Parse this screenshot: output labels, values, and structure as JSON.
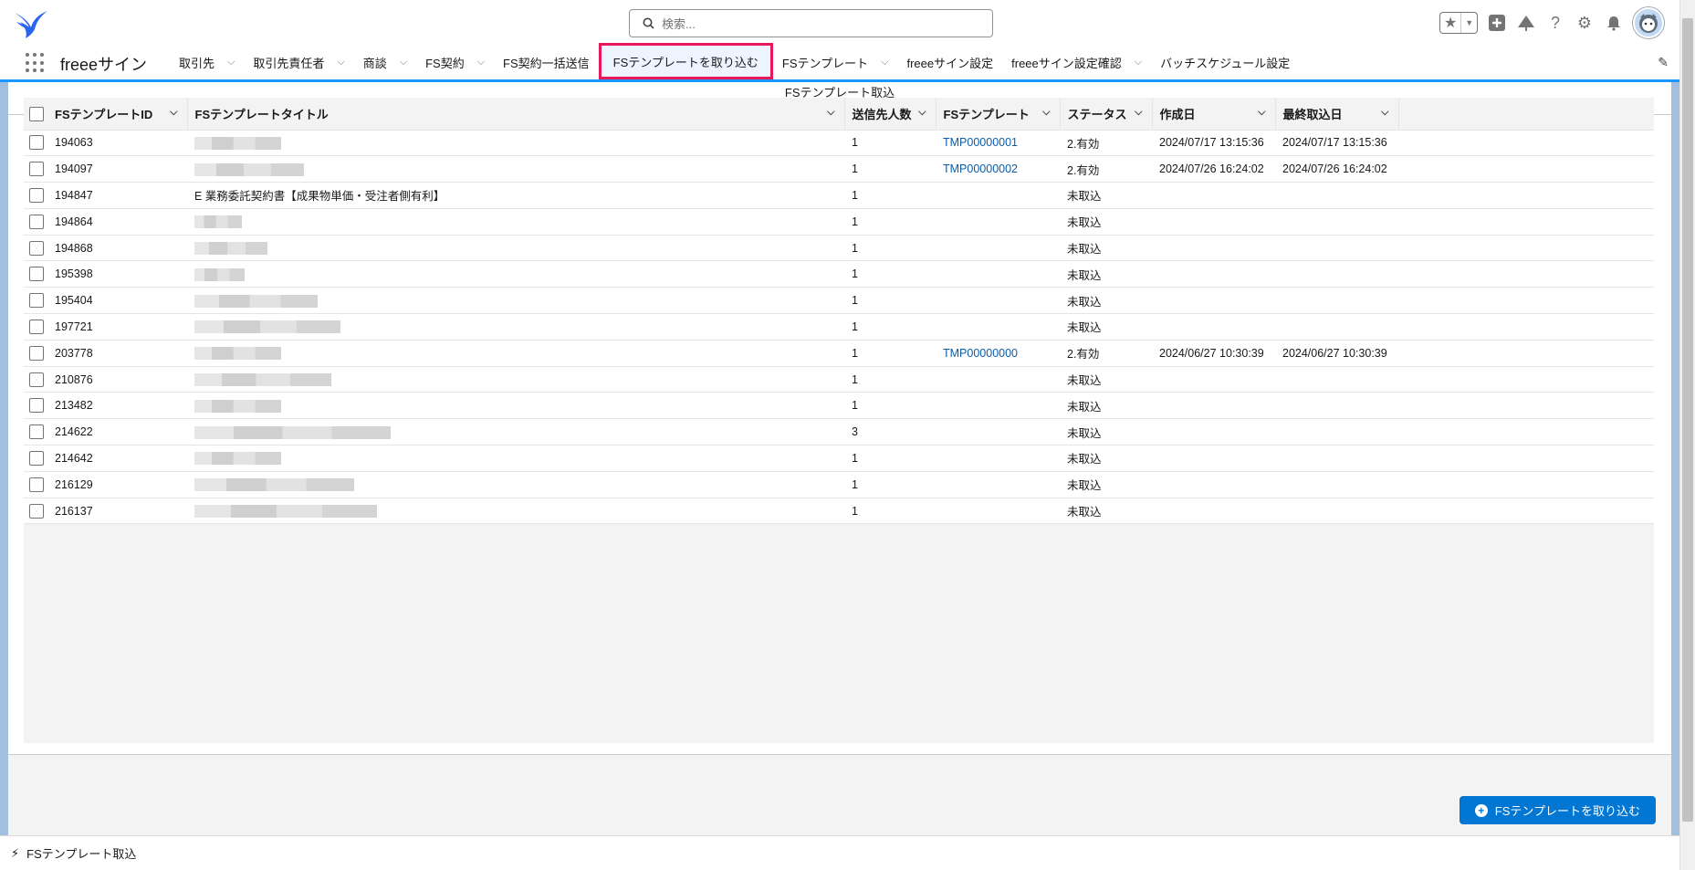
{
  "header": {
    "search_placeholder": "検索..."
  },
  "nav": {
    "app_name": "freeeサイン",
    "items": [
      {
        "label": "取引先",
        "dropdown": true
      },
      {
        "label": "取引先責任者",
        "dropdown": true
      },
      {
        "label": "商談",
        "dropdown": true
      },
      {
        "label": "FS契約",
        "dropdown": true
      },
      {
        "label": "FS契約一括送信",
        "dropdown": false
      },
      {
        "label": "FSテンプレートを取り込む",
        "dropdown": false,
        "active": true
      },
      {
        "label": "FSテンプレート",
        "dropdown": true
      },
      {
        "label": "freeeサイン設定",
        "dropdown": false
      },
      {
        "label": "freeeサイン設定確認",
        "dropdown": true
      },
      {
        "label": "バッチスケジュール設定",
        "dropdown": false
      }
    ]
  },
  "card": {
    "title": "FSテンプレート取込",
    "columns": [
      "FSテンプレートID",
      "FSテンプレートタイトル",
      "送信先人数",
      "FSテンプレート",
      "ステータス",
      "作成日",
      "最終取込日"
    ],
    "rows": [
      {
        "id": "194063",
        "title": "",
        "recipients": "1",
        "template": "TMP00000001",
        "status": "2.有効",
        "created": "2024/07/17 13:15:36",
        "imported": "2024/07/17 13:15:36"
      },
      {
        "id": "194097",
        "title": "",
        "recipients": "1",
        "template": "TMP00000002",
        "status": "2.有効",
        "created": "2024/07/26 16:24:02",
        "imported": "2024/07/26 16:24:02"
      },
      {
        "id": "194847",
        "title": "E 業務委託契約書【成果物単価・受注者側有利】",
        "recipients": "1",
        "template": "",
        "status": "未取込",
        "created": "",
        "imported": ""
      },
      {
        "id": "194864",
        "title": "",
        "recipients": "1",
        "template": "",
        "status": "未取込",
        "created": "",
        "imported": ""
      },
      {
        "id": "194868",
        "title": "",
        "recipients": "1",
        "template": "",
        "status": "未取込",
        "created": "",
        "imported": ""
      },
      {
        "id": "195398",
        "title": "",
        "recipients": "1",
        "template": "",
        "status": "未取込",
        "created": "",
        "imported": ""
      },
      {
        "id": "195404",
        "title": "",
        "recipients": "1",
        "template": "",
        "status": "未取込",
        "created": "",
        "imported": ""
      },
      {
        "id": "197721",
        "title": "",
        "recipients": "1",
        "template": "",
        "status": "未取込",
        "created": "",
        "imported": ""
      },
      {
        "id": "203778",
        "title": "",
        "recipients": "1",
        "template": "TMP00000000",
        "status": "2.有効",
        "created": "2024/06/27 10:30:39",
        "imported": "2024/06/27 10:30:39"
      },
      {
        "id": "210876",
        "title": "",
        "recipients": "1",
        "template": "",
        "status": "未取込",
        "created": "",
        "imported": ""
      },
      {
        "id": "213482",
        "title": "",
        "recipients": "1",
        "template": "",
        "status": "未取込",
        "created": "",
        "imported": ""
      },
      {
        "id": "214622",
        "title": "",
        "recipients": "3",
        "template": "",
        "status": "未取込",
        "created": "",
        "imported": ""
      },
      {
        "id": "214642",
        "title": "",
        "recipients": "1",
        "template": "",
        "status": "未取込",
        "created": "",
        "imported": ""
      },
      {
        "id": "216129",
        "title": "",
        "recipients": "1",
        "template": "",
        "status": "未取込",
        "created": "",
        "imported": ""
      },
      {
        "id": "216137",
        "title": "",
        "recipients": "1",
        "template": "",
        "status": "未取込",
        "created": "",
        "imported": ""
      }
    ],
    "import_button": "FSテンプレートを取り込む"
  },
  "utility_bar": {
    "label": "FSテンプレート取込"
  },
  "colors": {
    "brand": "#0176d3",
    "active_tab_border": "#e6195f",
    "link": "#0b5cab"
  }
}
